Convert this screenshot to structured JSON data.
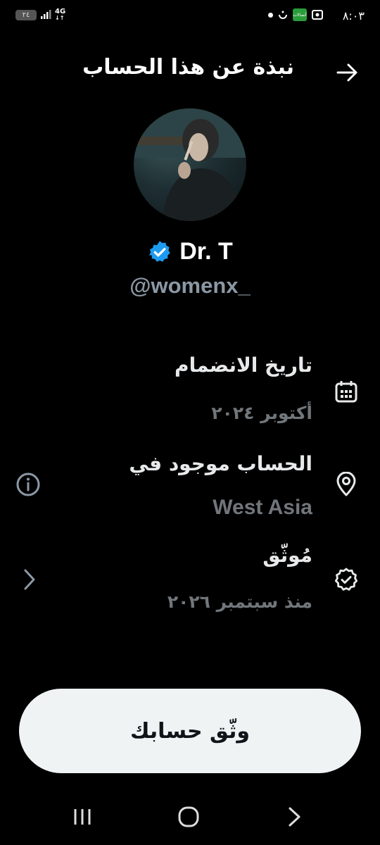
{
  "status_bar": {
    "time": "٨:٠٣",
    "battery": "٢٤",
    "network": "4G",
    "carrier_badge": "أتصالات"
  },
  "header": {
    "title": "نبذة عن هذا الحساب",
    "back_icon": "arrow-right-icon"
  },
  "profile": {
    "display_name": "Dr. T",
    "handle": "@womenx_",
    "verified_badge_color": "#1d9bf0"
  },
  "info": {
    "joined": {
      "label": "تاريخ الانضمام",
      "value": "أكتوبر ٢٠٢٤",
      "icon": "calendar-icon"
    },
    "location": {
      "label": "الحساب موجود في",
      "value": "West Asia",
      "icon": "location-pin-icon",
      "info_icon": "info-icon"
    },
    "verified": {
      "label": "مُوثّق",
      "value": "منذ سبتمبر ٢٠٢٦",
      "icon": "verified-check-icon",
      "chevron_icon": "chevron-right-icon"
    }
  },
  "cta": {
    "label": "وثّق حسابك"
  },
  "nav_bar": {
    "recents_icon": "recents-icon",
    "home_icon": "home-icon",
    "back_icon": "back-icon"
  }
}
